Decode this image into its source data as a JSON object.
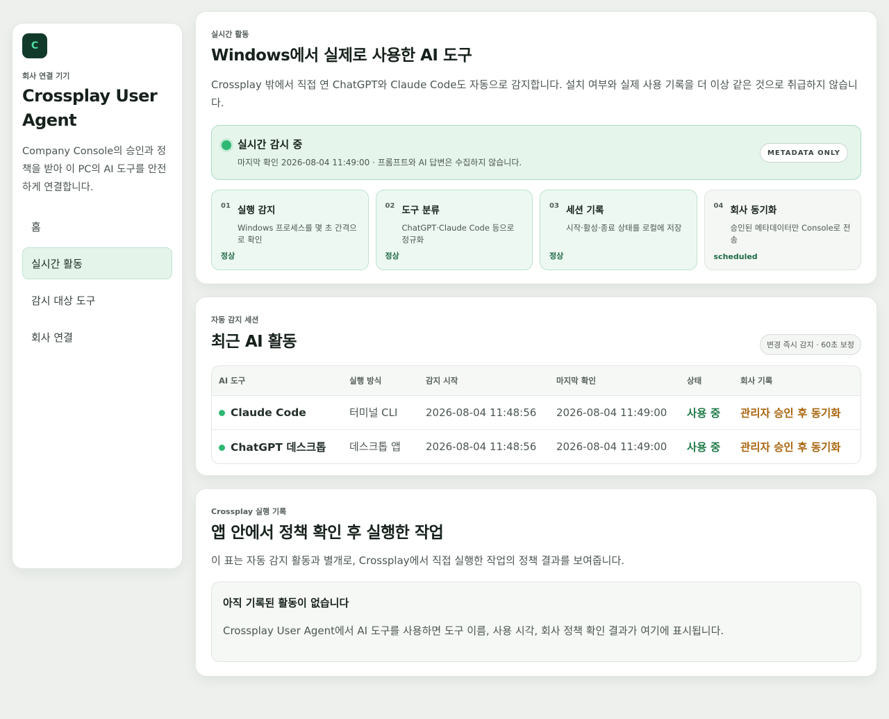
{
  "sidebar": {
    "logo_letter": "C",
    "eyebrow": "회사 연결 기기",
    "title": "Crossplay User Agent",
    "description": "Company Console의 승인과 정책을 받아 이 PC의 AI 도구를 안전하게 연결합니다.",
    "nav": [
      {
        "label": "홈",
        "active": false
      },
      {
        "label": "실시간 활동",
        "active": true
      },
      {
        "label": "감시 대상 도구",
        "active": false
      },
      {
        "label": "회사 연결",
        "active": false
      }
    ]
  },
  "realtime": {
    "eyebrow": "실시간 활동",
    "title": "Windows에서 실제로 사용한 AI 도구",
    "description": "Crossplay 밖에서 직접 연 ChatGPT와 Claude Code도 자동으로 감지합니다. 설치 여부와 실제 사용 기록을 더 이상 같은 것으로 취급하지 않습니다.",
    "monitor": {
      "title": "실시간 감시 중",
      "subtitle": "마지막 확인 2026-08-04 11:49:00 · 프롬프트와 AI 답변은 수집하지 않습니다.",
      "badge": "METADATA ONLY"
    },
    "steps": [
      {
        "num": "01",
        "title": "실행 감지",
        "desc": "Windows 프로세스를 몇 초 간격으로 확인",
        "status": "정상"
      },
      {
        "num": "02",
        "title": "도구 분류",
        "desc": "ChatGPT·Claude Code 등으로 정규화",
        "status": "정상"
      },
      {
        "num": "03",
        "title": "세션 기록",
        "desc": "시작·활성·종료 상태를 로컬에 저장",
        "status": "정상"
      },
      {
        "num": "04",
        "title": "회사 동기화",
        "desc": "승인된 메타데이터만 Console로 전송",
        "status": "scheduled"
      }
    ]
  },
  "sessions": {
    "eyebrow": "자동 감지 세션",
    "title": "최근 AI 활동",
    "pill": "변경 즉시 감지 · 60초 보정",
    "columns": [
      "AI 도구",
      "실행 방식",
      "감지 시작",
      "마지막 확인",
      "상태",
      "회사 기록"
    ],
    "rows": [
      {
        "tool": "Claude Code",
        "method": "터미널 CLI",
        "start": "2026-08-04 11:48:56",
        "last": "2026-08-04 11:49:00",
        "status": "사용 중",
        "sync": "관리자 승인 후 동기화"
      },
      {
        "tool": "ChatGPT 데스크톱",
        "method": "데스크톱 앱",
        "start": "2026-08-04 11:48:56",
        "last": "2026-08-04 11:49:00",
        "status": "사용 중",
        "sync": "관리자 승인 후 동기화"
      }
    ]
  },
  "history": {
    "eyebrow": "Crossplay 실행 기록",
    "title": "앱 안에서 정책 확인 후 실행한 작업",
    "description": "이 표는 자동 감지 활동과 별개로, Crossplay에서 직접 실행한 작업의 정책 결과를 보여줍니다.",
    "empty_title": "아직 기록된 활동이 없습니다",
    "empty_desc": "Crossplay User Agent에서 AI 도구를 사용하면 도구 이름, 사용 시각, 회사 정책 확인 결과가 여기에 표시됩니다."
  }
}
